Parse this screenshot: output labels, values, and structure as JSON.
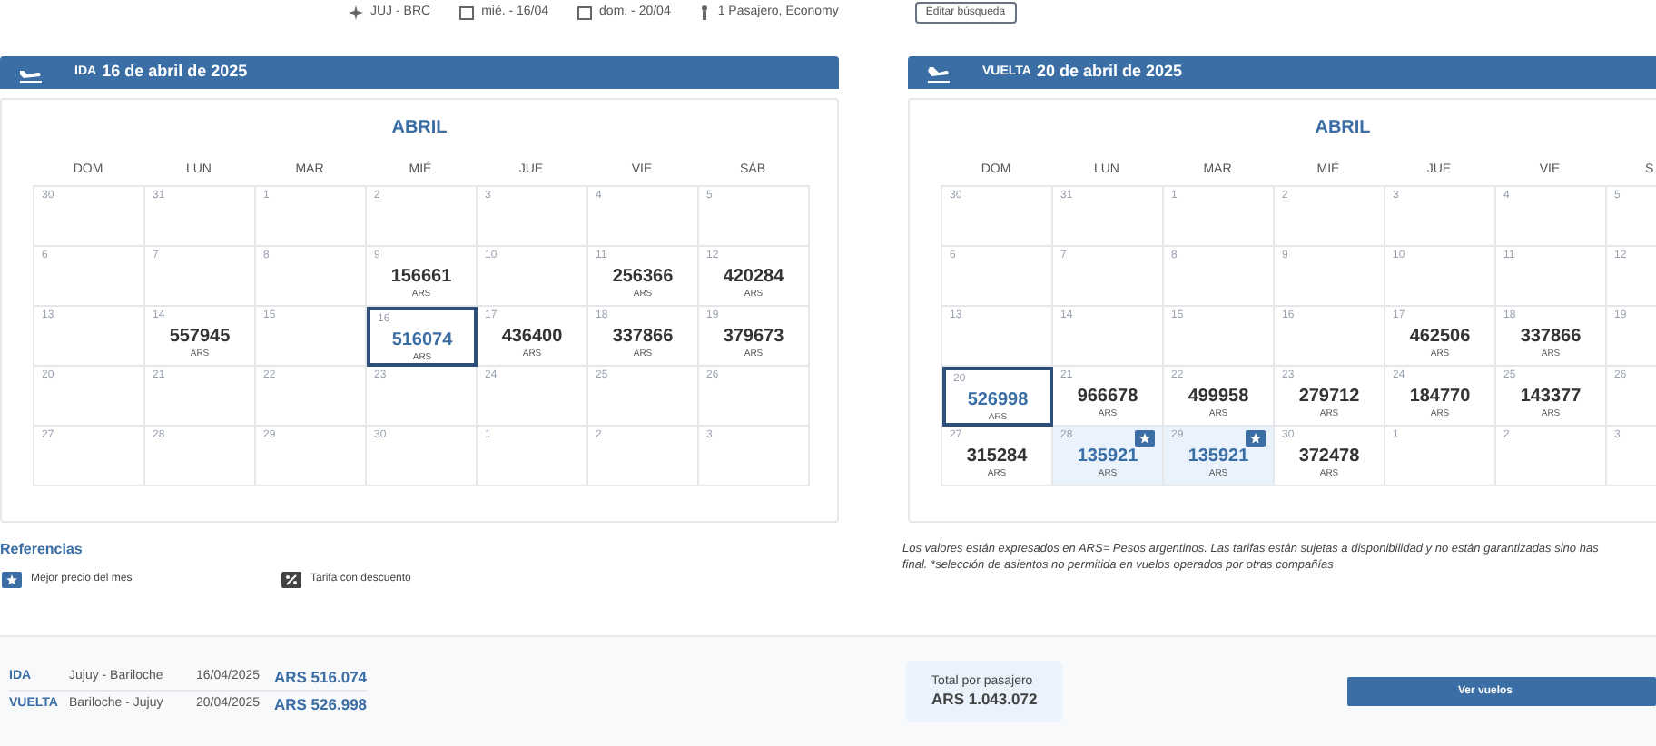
{
  "search_summary": {
    "route": "JUJ - BRC",
    "departure": "mié. - 16/04",
    "return": "dom. - 20/04",
    "passengers": "1 Pasajero, Economy",
    "edit_button": "Editar búsqueda"
  },
  "calendars": [
    {
      "direction": "IDA",
      "date": "16 de abril de 2025",
      "kind": "departure",
      "month": "ABRIL",
      "weekdays": [
        "DOM",
        "LUN",
        "MAR",
        "MIÉ",
        "JUE",
        "VIE",
        "SÁB"
      ],
      "weeks": [
        [
          {
            "day": "30",
            "selected": false,
            "best": false
          },
          {
            "day": "31",
            "selected": false,
            "best": false
          },
          {
            "day": "1",
            "selected": false,
            "best": false
          },
          {
            "day": "2",
            "selected": false,
            "best": false
          },
          {
            "day": "3",
            "selected": false,
            "best": false
          },
          {
            "day": "4",
            "selected": false,
            "best": false
          },
          {
            "day": "5",
            "selected": false,
            "best": false
          }
        ],
        [
          {
            "day": "6",
            "selected": false,
            "best": false
          },
          {
            "day": "7",
            "selected": false,
            "best": false
          },
          {
            "day": "8",
            "selected": false,
            "best": false
          },
          {
            "day": "9",
            "price": "156661",
            "currency": "ARS",
            "selected": false,
            "best": false
          },
          {
            "day": "10",
            "selected": false,
            "best": false
          },
          {
            "day": "11",
            "price": "256366",
            "currency": "ARS",
            "selected": false,
            "best": false
          },
          {
            "day": "12",
            "price": "420284",
            "currency": "ARS",
            "selected": false,
            "best": false
          }
        ],
        [
          {
            "day": "13",
            "selected": false,
            "best": false
          },
          {
            "day": "14",
            "price": "557945",
            "currency": "ARS",
            "selected": false,
            "best": false
          },
          {
            "day": "15",
            "selected": false,
            "best": false
          },
          {
            "day": "16",
            "price": "516074",
            "currency": "ARS",
            "selected": true,
            "best": false
          },
          {
            "day": "17",
            "price": "436400",
            "currency": "ARS",
            "selected": false,
            "best": false
          },
          {
            "day": "18",
            "price": "337866",
            "currency": "ARS",
            "selected": false,
            "best": false
          },
          {
            "day": "19",
            "price": "379673",
            "currency": "ARS",
            "selected": false,
            "best": false
          }
        ],
        [
          {
            "day": "20",
            "selected": false,
            "best": false
          },
          {
            "day": "21",
            "selected": false,
            "best": false
          },
          {
            "day": "22",
            "selected": false,
            "best": false
          },
          {
            "day": "23",
            "selected": false,
            "best": false
          },
          {
            "day": "24",
            "selected": false,
            "best": false
          },
          {
            "day": "25",
            "selected": false,
            "best": false
          },
          {
            "day": "26",
            "selected": false,
            "best": false
          }
        ],
        [
          {
            "day": "27",
            "selected": false,
            "best": false
          },
          {
            "day": "28",
            "selected": false,
            "best": false
          },
          {
            "day": "29",
            "selected": false,
            "best": false
          },
          {
            "day": "30",
            "selected": false,
            "best": false
          },
          {
            "day": "1",
            "selected": false,
            "best": false
          },
          {
            "day": "2",
            "selected": false,
            "best": false
          },
          {
            "day": "3",
            "selected": false,
            "best": false
          }
        ]
      ]
    },
    {
      "direction": "VUELTA",
      "date": "20 de abril de 2025",
      "kind": "return",
      "month": "ABRIL",
      "weekdays": [
        "DOM",
        "LUN",
        "MAR",
        "MIÉ",
        "JUE",
        "VIE",
        "S"
      ],
      "weeks": [
        [
          {
            "day": "30",
            "selected": false,
            "best": false
          },
          {
            "day": "31",
            "selected": false,
            "best": false
          },
          {
            "day": "1",
            "selected": false,
            "best": false
          },
          {
            "day": "2",
            "selected": false,
            "best": false
          },
          {
            "day": "3",
            "selected": false,
            "best": false
          },
          {
            "day": "4",
            "selected": false,
            "best": false
          },
          {
            "day": "5",
            "selected": false,
            "best": false
          }
        ],
        [
          {
            "day": "6",
            "selected": false,
            "best": false
          },
          {
            "day": "7",
            "selected": false,
            "best": false
          },
          {
            "day": "8",
            "selected": false,
            "best": false
          },
          {
            "day": "9",
            "selected": false,
            "best": false
          },
          {
            "day": "10",
            "selected": false,
            "best": false
          },
          {
            "day": "11",
            "selected": false,
            "best": false
          },
          {
            "day": "12",
            "selected": false,
            "best": false
          }
        ],
        [
          {
            "day": "13",
            "selected": false,
            "best": false
          },
          {
            "day": "14",
            "selected": false,
            "best": false
          },
          {
            "day": "15",
            "selected": false,
            "best": false
          },
          {
            "day": "16",
            "selected": false,
            "best": false
          },
          {
            "day": "17",
            "price": "462506",
            "currency": "ARS",
            "selected": false,
            "best": false
          },
          {
            "day": "18",
            "price": "337866",
            "currency": "ARS",
            "selected": false,
            "best": false
          },
          {
            "day": "19",
            "selected": false,
            "best": false
          }
        ],
        [
          {
            "day": "20",
            "price": "526998",
            "currency": "ARS",
            "selected": true,
            "best": false
          },
          {
            "day": "21",
            "price": "966678",
            "currency": "ARS",
            "selected": false,
            "best": false
          },
          {
            "day": "22",
            "price": "499958",
            "currency": "ARS",
            "selected": false,
            "best": false
          },
          {
            "day": "23",
            "price": "279712",
            "currency": "ARS",
            "selected": false,
            "best": false
          },
          {
            "day": "24",
            "price": "184770",
            "currency": "ARS",
            "selected": false,
            "best": false
          },
          {
            "day": "25",
            "price": "143377",
            "currency": "ARS",
            "selected": false,
            "best": false
          },
          {
            "day": "26",
            "selected": false,
            "best": false
          }
        ],
        [
          {
            "day": "27",
            "price": "315284",
            "currency": "ARS",
            "selected": false,
            "best": false
          },
          {
            "day": "28",
            "price": "135921",
            "currency": "ARS",
            "selected": false,
            "best": true
          },
          {
            "day": "29",
            "price": "135921",
            "currency": "ARS",
            "selected": false,
            "best": true
          },
          {
            "day": "30",
            "price": "372478",
            "currency": "ARS",
            "selected": false,
            "best": false
          },
          {
            "day": "1",
            "selected": false,
            "best": false
          },
          {
            "day": "2",
            "selected": false,
            "best": false
          },
          {
            "day": "3",
            "selected": false,
            "best": false
          }
        ]
      ]
    }
  ],
  "legend": {
    "title": "Referencias",
    "items": [
      {
        "kind": "best",
        "label": "Mejor precio del mes"
      },
      {
        "kind": "discount",
        "label": "Tarifa con descuento"
      }
    ]
  },
  "disclaimer": [
    "Los valores están expresados en ARS= Pesos argentinos. Las tarifas están sujetas a disponibilidad y no están garantizadas sino has",
    "final. *selección de asientos no permitida en vuelos operados por otras compañías"
  ],
  "summary": {
    "legs": [
      {
        "direction": "IDA",
        "route": "Jujuy - Bariloche",
        "date": "16/04/2025",
        "price": "ARS 516.074"
      },
      {
        "direction": "VUELTA",
        "route": "Bariloche - Jujuy",
        "date": "20/04/2025",
        "price": "ARS 526.998"
      }
    ],
    "total_label": "Total por pasajero",
    "total": "ARS 1.043.072",
    "button": "Ver vuelos"
  }
}
